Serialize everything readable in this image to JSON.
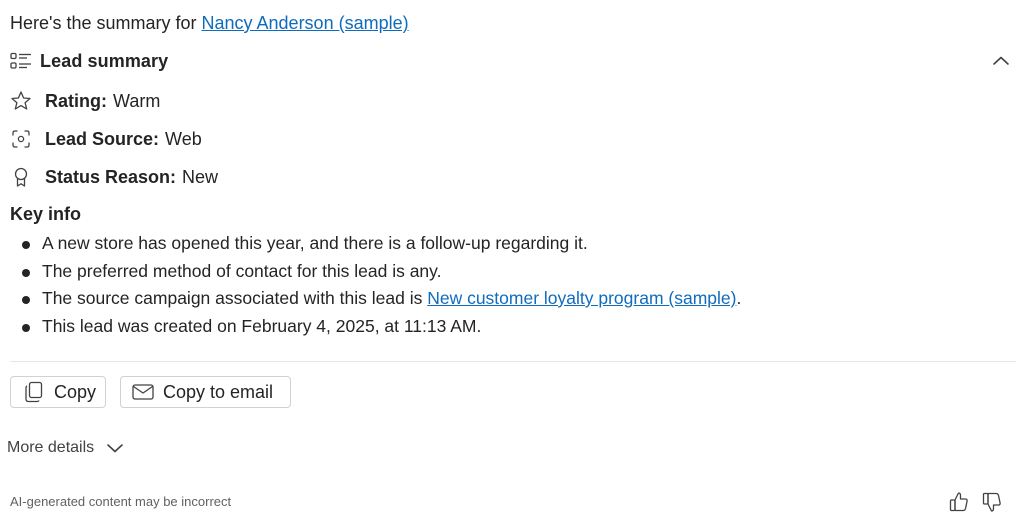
{
  "intro": {
    "prefix": "Here's the summary for ",
    "lead_name": "Nancy Anderson (sample)"
  },
  "summary": {
    "title": "Lead summary",
    "fields": [
      {
        "icon": "star-icon",
        "label": "Rating:",
        "value": "Warm"
      },
      {
        "icon": "lead-source-icon",
        "label": "Lead Source:",
        "value": "Web"
      },
      {
        "icon": "ribbon-icon",
        "label": "Status Reason:",
        "value": "New"
      }
    ]
  },
  "key_info": {
    "title": "Key info",
    "items": [
      {
        "text": "A new store has opened this year, and there is a follow-up regarding it."
      },
      {
        "text": "The preferred method of contact for this lead is any."
      },
      {
        "prefix": "The source campaign associated with this lead is ",
        "link": "New customer loyalty program (sample)",
        "suffix": "."
      },
      {
        "text": "This lead was created on February 4, 2025, at 11:13 AM."
      }
    ]
  },
  "actions": {
    "copy_label": "Copy",
    "copy_email_label": "Copy to email"
  },
  "more_details_label": "More details",
  "disclaimer": "AI-generated content may be incorrect",
  "colors": {
    "link": "#0f6cbd",
    "text": "#242424",
    "border": "#d1d1d1",
    "muted": "#616161"
  }
}
